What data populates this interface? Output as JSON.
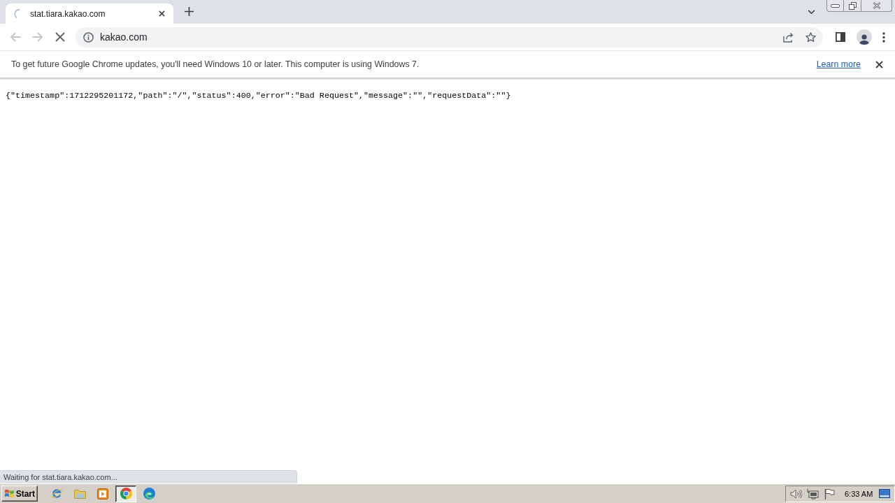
{
  "tab_strip": {
    "tabs": [
      {
        "title": "stat.tiara.kakao.com",
        "selected": true,
        "loading": true
      }
    ]
  },
  "toolbar": {
    "back": {
      "disabled": true
    },
    "forward": {
      "disabled": true
    },
    "loading": true,
    "address": "kakao.com"
  },
  "infobar": {
    "message": "To get future Google Chrome updates, you'll need Windows 10 or later. This computer is using Windows 7.",
    "link": "Learn more"
  },
  "page": {
    "body": "{\"timestamp\":1712295201172,\"path\":\"/\",\"status\":400,\"error\":\"Bad Request\",\"message\":\"\",\"requestData\":\"\"}"
  },
  "status_bubble": {
    "text": "Waiting for stat.tiara.kakao.com..."
  },
  "taskbar": {
    "start": "Start",
    "apps": [
      {
        "kind": "ie",
        "selected": false
      },
      {
        "kind": "explorer",
        "selected": false
      },
      {
        "kind": "media",
        "selected": false
      },
      {
        "kind": "chrome",
        "selected": true
      },
      {
        "kind": "edge",
        "selected": false
      }
    ],
    "clock": "6:33 AM"
  }
}
